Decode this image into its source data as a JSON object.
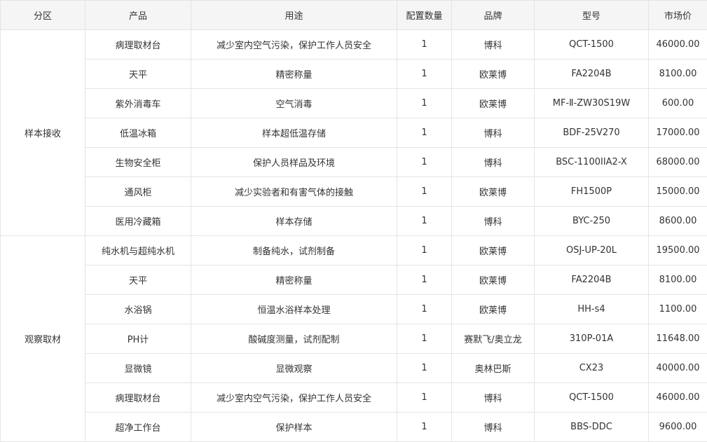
{
  "table": {
    "headers": [
      "分区",
      "产品",
      "用途",
      "配置数量",
      "品牌",
      "型号",
      "市场价"
    ],
    "groups": [
      {
        "zone": "样本接收",
        "rows": [
          [
            "病理取材台",
            "减少室内空气污染，保护工作人员安全",
            "1",
            "博科",
            "QCT-1500",
            "46000.00"
          ],
          [
            "天平",
            "精密称量",
            "1",
            "欧莱博",
            "FA2204B",
            "8100.00"
          ],
          [
            "紫外消毒车",
            "空气消毒",
            "1",
            "欧莱博",
            "MF-Ⅱ-ZW30S19W",
            "600.00"
          ],
          [
            "低温冰箱",
            "样本超低温存储",
            "1",
            "博科",
            "BDF-25V270",
            "17000.00"
          ],
          [
            "生物安全柜",
            "保护人员样品及环境",
            "1",
            "博科",
            "BSC-1100IIA2-X",
            "68000.00"
          ],
          [
            "通风柜",
            "减少实验者和有害气体的接触",
            "1",
            "欧莱博",
            "FH1500P",
            "15000.00"
          ],
          [
            "医用冷藏箱",
            "样本存储",
            "1",
            "博科",
            "BYC-250",
            "8600.00"
          ]
        ]
      },
      {
        "zone": "观察取材",
        "rows": [
          [
            "纯水机与超纯水机",
            "制备纯水，试剂制备",
            "1",
            "欧莱博",
            "OSJ-UP-20L",
            "19500.00"
          ],
          [
            "天平",
            "精密称量",
            "1",
            "欧莱博",
            "FA2204B",
            "8100.00"
          ],
          [
            "水浴锅",
            "恒温水浴样本处理",
            "1",
            "欧莱博",
            "HH-s4",
            "1100.00"
          ],
          [
            "PH计",
            "酸碱度测量，试剂配制",
            "1",
            "赛默飞/奥立龙",
            "310P-01A",
            "11648.00"
          ],
          [
            "显微镜",
            "显微观察",
            "1",
            "奥林巴斯",
            "CX23",
            "40000.00"
          ],
          [
            "病理取材台",
            "减少室内空气污染，保护工作人员安全",
            "1",
            "博科",
            "QCT-1500",
            "46000.00"
          ],
          [
            "超净工作台",
            "保护样本",
            "1",
            "博科",
            "BBS-DDC",
            "9600.00"
          ]
        ]
      }
    ]
  }
}
